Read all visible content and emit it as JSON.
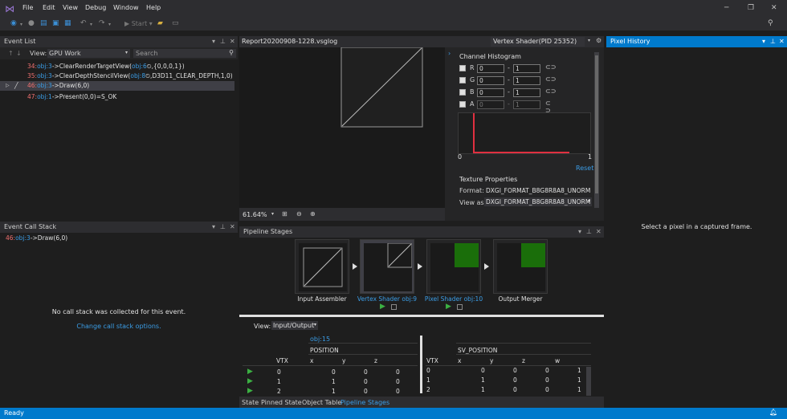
{
  "menubar": {
    "items": [
      "File",
      "Edit",
      "View",
      "Debug",
      "Window",
      "Help"
    ]
  },
  "toolbar": {
    "start_label": "Start"
  },
  "event_list": {
    "title": "Event List",
    "view_label": "View:",
    "view_value": "GPU Work",
    "search_placeholder": "Search",
    "rows": [
      {
        "id": "34:",
        "obj": "obj:3",
        "call": "->ClearRenderTargetView(",
        "arg_obj": "obj:6",
        "args": ",{0,0,0,1})"
      },
      {
        "id": "35:",
        "obj": "obj:3",
        "call": "->ClearDepthStencilView(",
        "arg_obj": "obj:8",
        "args": ",D3D11_CLEAR_DEPTH,1,0)"
      },
      {
        "id": "46:",
        "obj": "obj:3",
        "call": "->Draw(6,0)",
        "arg_obj": "",
        "args": ""
      },
      {
        "id": "47:",
        "obj": "obj:1",
        "call": "->Present(0,0)=S_OK",
        "arg_obj": "",
        "args": ""
      }
    ]
  },
  "call_stack": {
    "title": "Event Call Stack",
    "entry_id": "46:",
    "entry_obj": "obj:3",
    "entry_call": "->Draw(6,0)",
    "message": "No call stack was collected for this event.",
    "link": "Change call stack options."
  },
  "doc": {
    "tab_label": "Report20200908-1228.vsglog",
    "shader_select": "Vertex Shader(PID 25352)",
    "zoom": "61.64%"
  },
  "histogram": {
    "title": "Channel Histogram",
    "channels": [
      {
        "name": "R",
        "min": "0",
        "max": "1",
        "checked": true
      },
      {
        "name": "G",
        "min": "0",
        "max": "1",
        "checked": true
      },
      {
        "name": "B",
        "min": "0",
        "max": "1",
        "checked": true
      },
      {
        "name": "A",
        "min": "0",
        "max": "1",
        "checked": false
      }
    ],
    "axis_min": "0",
    "axis_max": "1",
    "reset": "Reset",
    "tex_props_title": "Texture Properties",
    "format_label": "Format:",
    "format_value": "DXGI_FORMAT_B8G8R8A8_UNORM",
    "viewas_label": "View as:",
    "viewas_value": "DXGI_FORMAT_B8G8R8A8_UNORM",
    "colors": {
      "marker": "#e03040"
    }
  },
  "pipeline": {
    "title": "Pipeline Stages",
    "stages": [
      {
        "label": "Input Assembler"
      },
      {
        "label": "Vertex Shader obj:9"
      },
      {
        "label": "Pixel Shader obj:10"
      },
      {
        "label": "Output Merger"
      }
    ],
    "view_label": "View:",
    "view_value": "Input/Output",
    "left_table": {
      "obj": "obj:15",
      "group": "POSITION",
      "headers": [
        "VTX",
        "x",
        "y",
        "z"
      ],
      "rows": [
        [
          "0",
          "0",
          "0",
          "0"
        ],
        [
          "1",
          "1",
          "0",
          "0"
        ],
        [
          "2",
          "1",
          "0",
          "0"
        ]
      ]
    },
    "right_table": {
      "group": "SV_POSITION",
      "headers": [
        "VTX",
        "x",
        "y",
        "z",
        "w"
      ],
      "rows": [
        [
          "0",
          "0",
          "0",
          "0",
          "1"
        ],
        [
          "1",
          "1",
          "0",
          "0",
          "1"
        ],
        [
          "2",
          "1",
          "0",
          "0",
          "1"
        ]
      ]
    }
  },
  "bottom_tabs": [
    "State",
    "Pinned State",
    "Object Table",
    "Pipeline Stages"
  ],
  "pixel_history": {
    "title": "Pixel History",
    "message": "Select a pixel in a captured frame."
  },
  "status": {
    "text": "Ready"
  },
  "colors": {
    "accent": "#007acc",
    "link": "#3b9de6",
    "event_id": "#f07070",
    "green": "#1a6e0a"
  }
}
